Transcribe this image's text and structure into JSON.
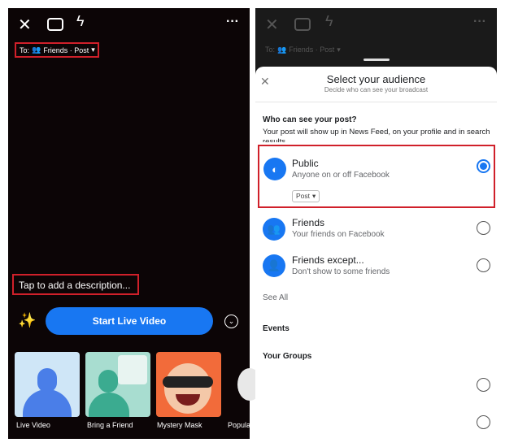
{
  "left": {
    "audience_prefix": "To:",
    "audience": "Friends · Post",
    "description_placeholder": "Tap to add a description...",
    "start_button": "Start Live Video",
    "effects": [
      {
        "label": "Live Video"
      },
      {
        "label": "Bring a Friend"
      },
      {
        "label": "Mystery Mask"
      },
      {
        "label": "Popula"
      }
    ]
  },
  "right": {
    "audience_prefix": "To:",
    "audience": "Friends · Post",
    "title": "Select your audience",
    "subtitle": "Decide who can see your broadcast",
    "question": "Who can see your post?",
    "explanation": "Your post will show up in News Feed, on your profile and in search results",
    "options": [
      {
        "title": "Public",
        "desc": "Anyone on or off Facebook",
        "selected": true,
        "dropdown": "Post"
      },
      {
        "title": "Friends",
        "desc": "Your friends on Facebook",
        "selected": false
      },
      {
        "title": "Friends except...",
        "desc": "Don't show to some friends",
        "selected": false
      }
    ],
    "see_all": "See All",
    "events": "Events",
    "groups": "Your Groups"
  },
  "colors": {
    "accent": "#1877f2",
    "highlight": "#d0202a"
  }
}
